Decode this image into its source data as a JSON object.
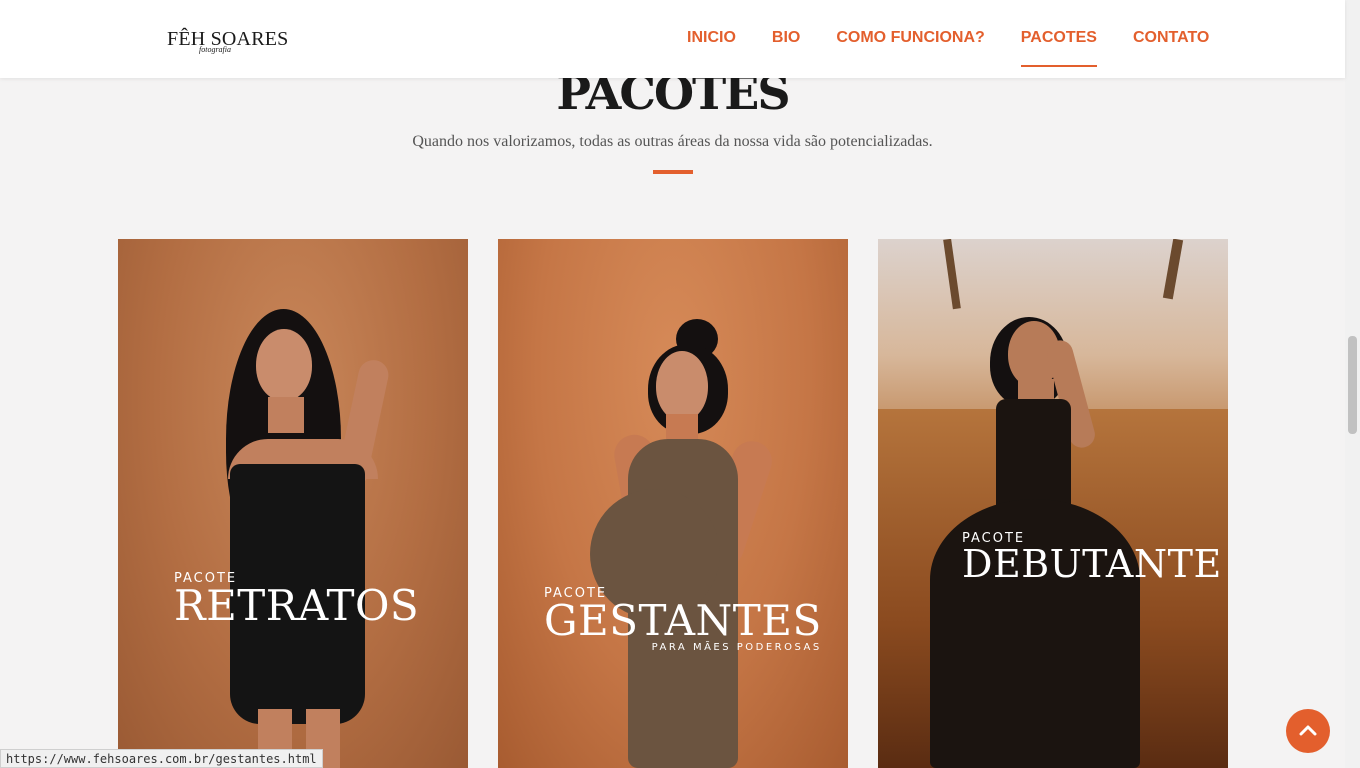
{
  "header": {
    "logo": {
      "name": "FÊH SOARES",
      "tagline": "fotografia"
    },
    "nav": [
      {
        "label": "INICIO",
        "active": false
      },
      {
        "label": "BIO",
        "active": false
      },
      {
        "label": "COMO FUNCIONA?",
        "active": false
      },
      {
        "label": "PACOTES",
        "active": true
      },
      {
        "label": "CONTATO",
        "active": false
      }
    ]
  },
  "section": {
    "title": "PACOTES",
    "subtitle": "Quando nos valorizamos, todas as outras áreas da nossa vida são potencializadas."
  },
  "cards": [
    {
      "small": "PACOTE",
      "big": "RETRATOS",
      "tag": ""
    },
    {
      "small": "PACOTE",
      "big": "GESTANTES",
      "tag": "PARA MÃES PODEROSAS"
    },
    {
      "small": "PACOTE",
      "big": "DEBUTANTE",
      "tag": ""
    }
  ],
  "status_url": "https://www.fehsoares.com.br/gestantes.html",
  "colors": {
    "accent": "#e35f2d",
    "background": "#f4f3f3"
  },
  "icons": {
    "back_to_top": "chevron-up-icon"
  }
}
